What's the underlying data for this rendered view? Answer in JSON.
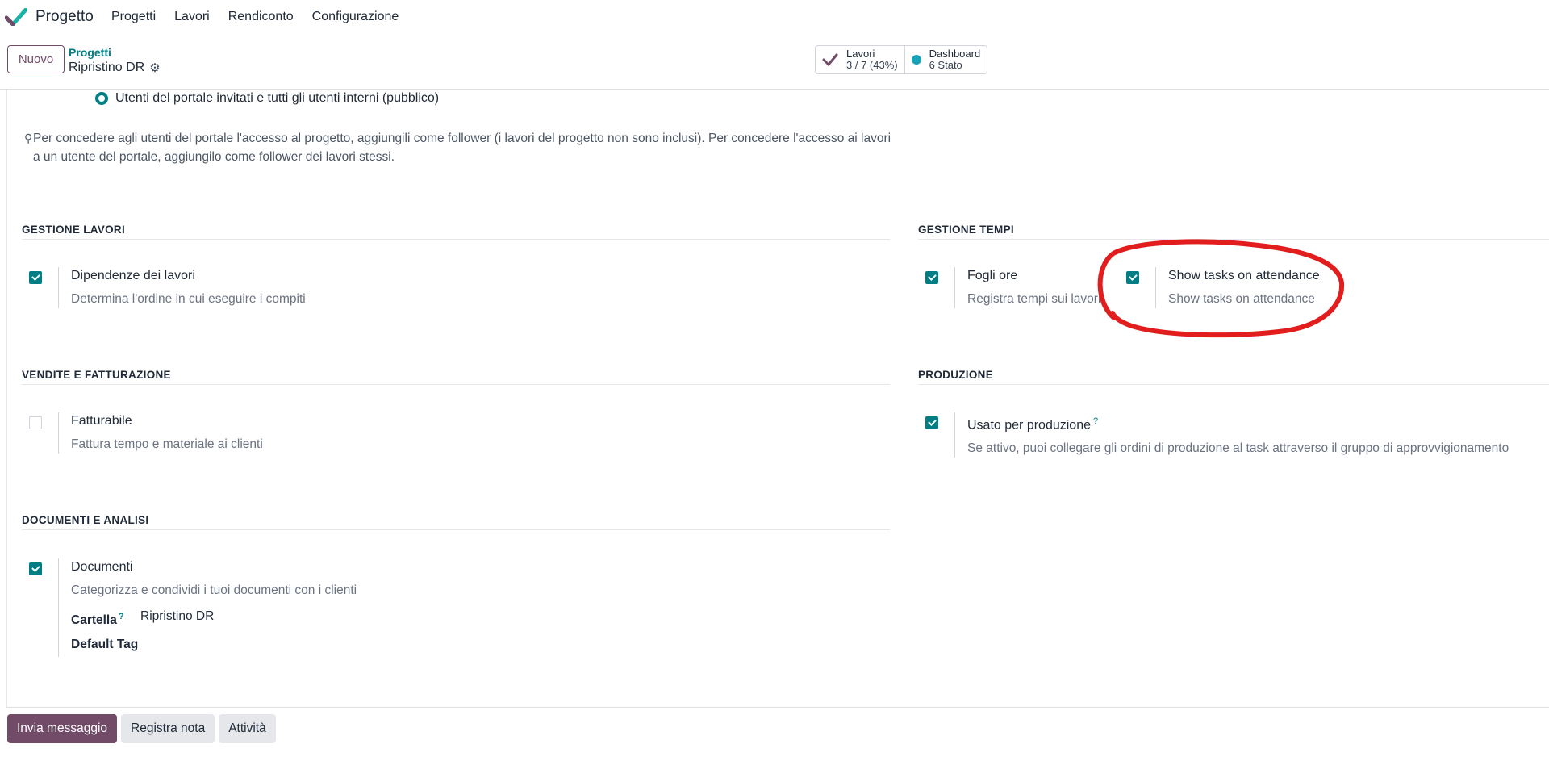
{
  "app": {
    "brand": "Progetto",
    "menu": [
      "Progetti",
      "Lavori",
      "Rendiconto",
      "Configurazione"
    ]
  },
  "control_panel": {
    "new_label": "Nuovo",
    "breadcrumb_parent": "Progetti",
    "breadcrumb_current": "Ripristino DR",
    "smart_buttons": [
      {
        "title": "Lavori",
        "value": "3 / 7 (43%)",
        "icon": "check-icon"
      },
      {
        "title": "Dashboard",
        "value": "6 Stato",
        "icon": "status-dot-icon"
      }
    ]
  },
  "visibility": {
    "selected_option": "Utenti del portale invitati e tutti gli utenti interni (pubblico)",
    "hint_line1": "Per concedere agli utenti del portale l'accesso al progetto, aggiungili come follower (i lavori del progetto non sono inclusi). Per concedere l'accesso ai lavori",
    "hint_line2": "a un utente del portale, aggiungilo come follower dei lavori stessi."
  },
  "sections": {
    "gestione_lavori": "GESTIONE LAVORI",
    "gestione_tempi": "GESTIONE TEMPI",
    "vendite": "VENDITE E FATTURAZIONE",
    "produzione": "PRODUZIONE",
    "documenti": "DOCUMENTI E ANALISI"
  },
  "settings": {
    "dipendenze": {
      "title": "Dipendenze dei lavori",
      "desc": "Determina l'ordine in cui eseguire i compiti",
      "checked": true
    },
    "fogli_ore": {
      "title": "Fogli ore",
      "desc": "Registra tempi sui lavori",
      "checked": true
    },
    "attendance": {
      "title": "Show tasks on attendance",
      "desc": "Show tasks on attendance",
      "checked": true
    },
    "fatturabile": {
      "title": "Fatturabile",
      "desc": "Fattura tempo e materiale ai clienti",
      "checked": false
    },
    "produzione": {
      "title": "Usato per produzione",
      "help": "?",
      "desc": "Se attivo, puoi collegare gli ordini di produzione al task attraverso il gruppo di approvvigionamento",
      "checked": true
    },
    "documenti": {
      "title": "Documenti",
      "desc": "Categorizza e condividi i tuoi documenti con i clienti",
      "checked": true,
      "folder_label": "Cartella",
      "folder_help": "?",
      "folder_value": "Ripristino DR",
      "tag_label": "Default Tag"
    }
  },
  "chatter": {
    "send_message": "Invia messaggio",
    "log_note": "Registra nota",
    "activities": "Attività"
  },
  "colors": {
    "primary": "#714b67",
    "accent": "#017e84",
    "annotation": "#e11d1d"
  }
}
